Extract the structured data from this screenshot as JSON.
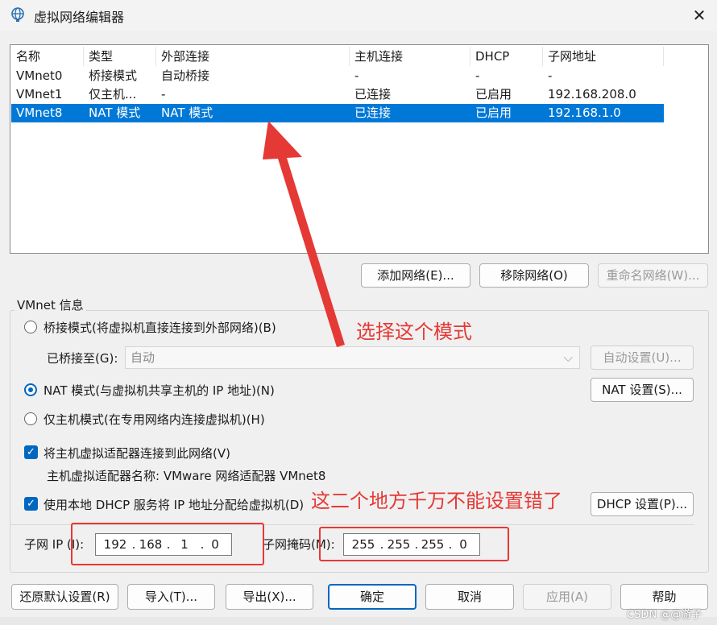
{
  "window": {
    "title": "虚拟网络编辑器",
    "close": "✕"
  },
  "table": {
    "headers": [
      "名称",
      "类型",
      "外部连接",
      "主机连接",
      "DHCP",
      "子网地址"
    ],
    "rows": [
      [
        "VMnet0",
        "桥接模式",
        "自动桥接",
        "-",
        "-",
        "-"
      ],
      [
        "VMnet1",
        "仅主机...",
        "-",
        "已连接",
        "已启用",
        "192.168.208.0"
      ],
      [
        "VMnet8",
        "NAT 模式",
        "NAT 模式",
        "已连接",
        "已启用",
        "192.168.1.0"
      ]
    ],
    "selected_row": 2
  },
  "table_buttons": {
    "add": "添加网络(E)...",
    "remove": "移除网络(O)",
    "rename": "重命名网络(W)..."
  },
  "vmnet_info": {
    "group_label": "VMnet 信息",
    "bridge_radio": "桥接模式(将虚拟机直接连接到外部网络)(B)",
    "bridged_to_label": "已桥接至(G):",
    "bridged_to_value": "自动",
    "auto_settings": "自动设置(U)...",
    "nat_radio": "NAT 模式(与虚拟机共享主机的 IP 地址)(N)",
    "nat_settings": "NAT 设置(S)...",
    "host_only_radio": "仅主机模式(在专用网络内连接虚拟机)(H)",
    "connect_adapter_check": "将主机虚拟适配器连接到此网络(V)",
    "adapter_name": "主机虚拟适配器名称: VMware 网络适配器 VMnet8",
    "dhcp_check": "使用本地 DHCP 服务将 IP 地址分配给虚拟机(D)",
    "dhcp_settings": "DHCP 设置(P)...",
    "subnet_ip_label": "子网 IP (I):",
    "subnet_ip": [
      "192",
      "168",
      "1",
      "0"
    ],
    "subnet_mask_label": "子网掩码(M):",
    "subnet_mask": [
      "255",
      "255",
      "255",
      "0"
    ]
  },
  "footer_buttons": {
    "restore": "还原默认设置(R)",
    "import": "导入(T)...",
    "export": "导出(X)...",
    "ok": "确定",
    "cancel": "取消",
    "apply": "应用(A)",
    "help": "帮助"
  },
  "annotations": {
    "choose_mode": "选择这个模式",
    "warning": "这二个地方千万不能设置错了"
  },
  "watermark": "CSDN @@游子",
  "colors": {
    "accent": "#0067c0",
    "selection": "#0078d7",
    "annotation": "#e53935"
  }
}
